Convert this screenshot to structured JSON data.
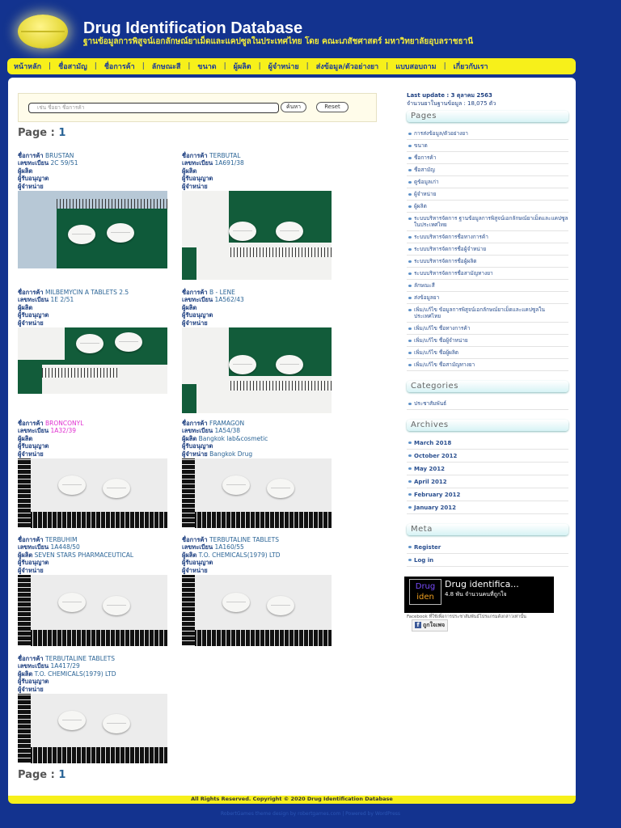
{
  "header": {
    "title": "Drug Identification Database",
    "subtitle": "ฐานข้อมูลการพิสูจน์เอกลักษณ์ยาเม็ดและแคปซูลในประเทศไทย โดย คณะเภสัชศาสตร์ มหาวิทยาลัยอุบลราชธานี",
    "logo_icon": "pill-icon"
  },
  "nav": [
    "หน้าหลัก",
    "ชื่อสามัญ",
    "ชื่อการค้า",
    "ลักษณะสี",
    "ขนาด",
    "ผู้ผลิต",
    "ผู้จำหน่าย",
    "ส่งข้อมูล/ตัวอย่างยา",
    "แบบสอบถาม",
    "เกี่ยวกับเรา"
  ],
  "search": {
    "placeholder": "เช่น ชื่อยา ชื่อการค้า",
    "search_label": "ค้นหา",
    "reset_label": "Reset"
  },
  "pager": {
    "label": "Page :",
    "page": "1"
  },
  "labels": {
    "trade": "ชื่อการค้า",
    "reg": "เลขทะเบียน",
    "maker": "ผู้ผลิต",
    "licensee": "ผู้รับอนุญาต",
    "distributor": "ผู้จำหน่าย"
  },
  "drugs": [
    {
      "trade": "BRUSTAN",
      "reg": "2C 59/51",
      "maker": "",
      "licensee": "",
      "distributor": ""
    },
    {
      "trade": "TERBUTAL",
      "reg": "1A691/38",
      "maker": "",
      "licensee": "",
      "distributor": ""
    },
    {
      "trade": "MILBEMYCIN A TABLETS 2.5",
      "reg": "1E 2/51",
      "maker": "",
      "licensee": "",
      "distributor": ""
    },
    {
      "trade": "B - LENE",
      "reg": "1A562/43",
      "maker": "",
      "licensee": "",
      "distributor": ""
    },
    {
      "trade": "BRONCONYL",
      "reg": "1A32/39",
      "maker": "",
      "licensee": "",
      "distributor": ""
    },
    {
      "trade": "FRAMAGON",
      "reg": "1A54/38",
      "maker": "Bangkok lab&cosmetic",
      "licensee": "",
      "distributor": "Bangkok Drug"
    },
    {
      "trade": "TERBUHIM",
      "reg": "1A448/50",
      "maker": "SEVEN STARS PHARMACEUTICAL",
      "licensee": "",
      "distributor": ""
    },
    {
      "trade": "TERBUTALINE TABLETS",
      "reg": "1A160/55",
      "maker": "T.O. CHEMICALS(1979) LTD",
      "licensee": "",
      "distributor": ""
    },
    {
      "trade": "TERBUTALINE TABLETS",
      "reg": "1A417/29",
      "maker": "T.O. CHEMICALS(1979) LTD",
      "licensee": "",
      "distributor": ""
    }
  ],
  "sidebar": {
    "last_update": "Last update : 3 ตุลาคม 2563",
    "count": "จำนวนยาในฐานข้อมูล : 18,075 ตัว",
    "pages_title": "Pages",
    "pages": [
      "การส่งข้อมูล/ตัวอย่างยา",
      "ขนาด",
      "ชื่อการค้า",
      "ชื่อสามัญ",
      "ดูข้อมูลเก่า",
      "ผู้จำหน่าย",
      "ผู้ผลิต",
      "ระบบบริหารจัดการ ฐานข้อมูลการพิสูจน์เอกลักษณ์ยาเม็ดและแคปซูลในประเทศไทย",
      "ระบบบริหารจัดการชื่อทางการค้า",
      "ระบบบริหารจัดการชื่อผู้จำหน่าย",
      "ระบบบริหารจัดการชื่อผู้ผลิต",
      "ระบบบริหารจัดการชื่อสามัญทางยา",
      "ลักษณะสี",
      "ส่งข้อมูลยา",
      "เพิ่ม/แก้ไข ข้อมูลการพิสูจน์เอกลักษณ์ยาเม็ดและแคปซูลในประเทศไทย",
      "เพิ่ม/แก้ไข ชื่อทางการค้า",
      "เพิ่ม/แก้ไข ชื่อผู้จำหน่าย",
      "เพิ่ม/แก้ไข ชื่อผู้ผลิต",
      "เพิ่ม/แก้ไข ชื่อสามัญทางยา"
    ],
    "categories_title": "Categories",
    "categories": [
      "ประชาสัมพันธ์"
    ],
    "archives_title": "Archives",
    "archives": [
      "March 2018",
      "October 2012",
      "May 2012",
      "April 2012",
      "February 2012",
      "January 2012"
    ],
    "meta_title": "Meta",
    "meta": [
      "Register",
      "Log in"
    ],
    "fb": {
      "name": "Drug identifica...",
      "likes": "4.8 พัน จำนวนคนที่ถูกใจ",
      "logo_top": "Drug",
      "logo_bottom": "iden",
      "note": "Facebook ที่ใช้เพื่อการประชาสัมพันธ์โปรแกรมดังกล่าวเท่านั้น",
      "like_label": "ถูกใจเพจ"
    }
  },
  "footer": {
    "copyright": "All Rights Reserved. Copyright © 2020 Drug Identification Database",
    "credits": "RobertGames theme design by robertgames.com | Powered by WordPress"
  },
  "colors": {
    "bg": "#13338f",
    "accent": "#f7f01a",
    "link": "#2a6496",
    "highlight": "#e02fd0"
  }
}
